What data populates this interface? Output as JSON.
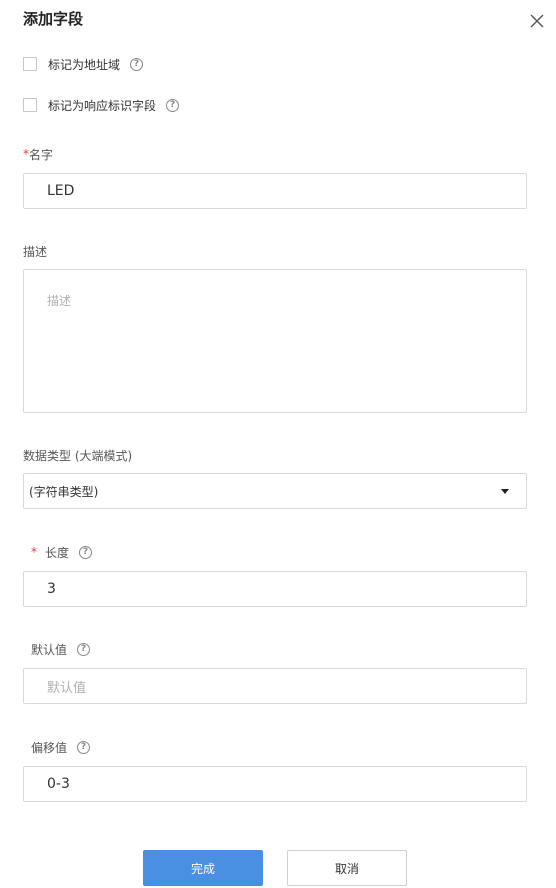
{
  "dialog": {
    "title": "添加字段",
    "close_icon": "close-icon"
  },
  "checkboxes": [
    {
      "label": "标记为地址域",
      "checked": false,
      "help": "?"
    },
    {
      "label": "标记为响应标识字段",
      "checked": false,
      "help": "?"
    }
  ],
  "fields": {
    "name": {
      "required_mark": "*",
      "label": "名字",
      "value": "LED"
    },
    "description": {
      "label": "描述",
      "value": "",
      "placeholder": "描述"
    },
    "data_type": {
      "label": "数据类型 (大端模式)",
      "selected": "(字符串类型)"
    },
    "length": {
      "required_mark": "*",
      "label": "长度",
      "help": "?",
      "value": "3"
    },
    "default_value": {
      "label": "默认值",
      "help": "?",
      "value": "",
      "placeholder": "默认值"
    },
    "offset": {
      "label": "偏移值",
      "help": "?",
      "value": "0-3"
    }
  },
  "buttons": {
    "confirm": "完成",
    "cancel": "取消"
  },
  "colors": {
    "primary": "#4a90e2",
    "required": "#e4393c",
    "border": "#d9d9d9"
  }
}
